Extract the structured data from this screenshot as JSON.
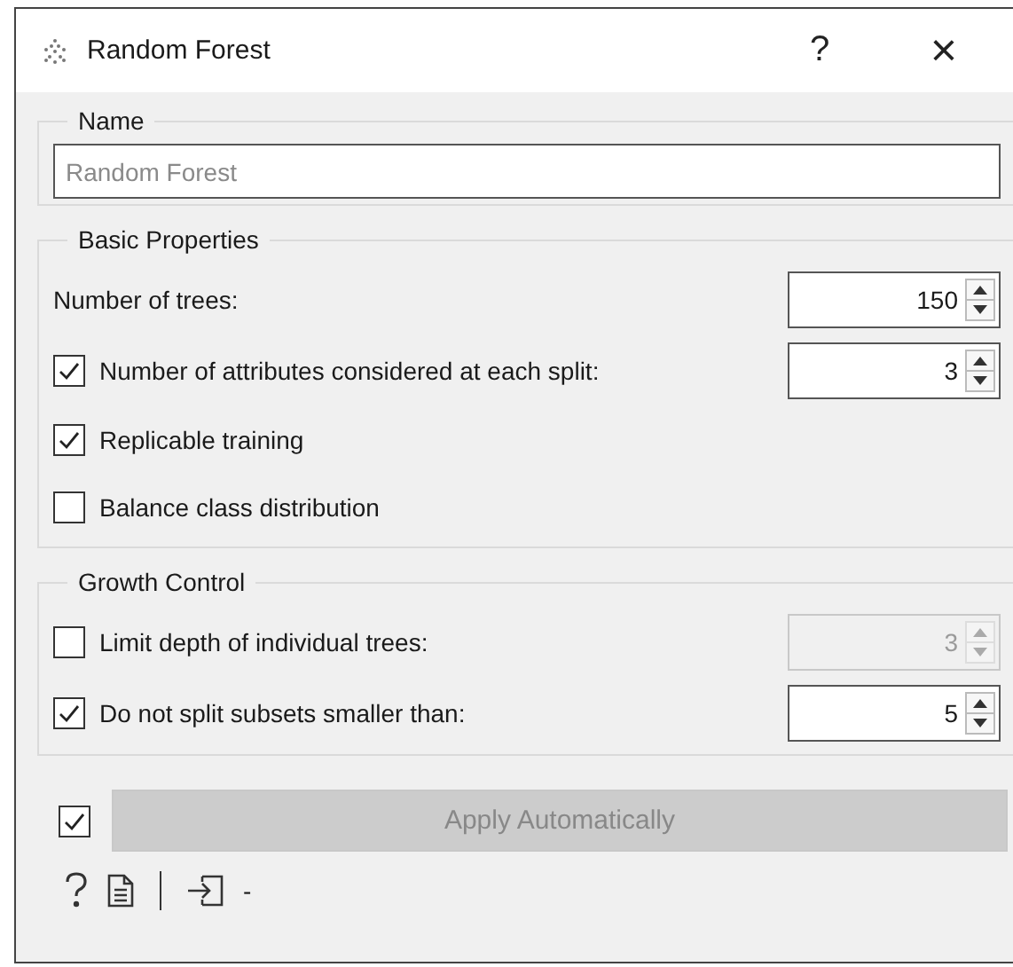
{
  "window": {
    "title": "Random Forest",
    "help": "?",
    "close": "×"
  },
  "name_group": {
    "title": "Name",
    "placeholder": "Random Forest"
  },
  "basic_properties": {
    "title": "Basic Properties",
    "rows": [
      {
        "kind": "spin",
        "label": "Number of trees:",
        "value": "150",
        "disabled": false
      },
      {
        "kind": "check-spin",
        "label": "Number of attributes considered at each split:",
        "checked": true,
        "value": "3",
        "disabled": false
      },
      {
        "kind": "check",
        "label": "Replicable training",
        "checked": true
      },
      {
        "kind": "check",
        "label": "Balance class distribution",
        "checked": false
      }
    ]
  },
  "growth_control": {
    "title": "Growth Control",
    "rows": [
      {
        "kind": "check-spin",
        "label": "Limit depth of individual trees:",
        "checked": false,
        "value": "3",
        "disabled": true
      },
      {
        "kind": "check-spin",
        "label": "Do not split subsets smaller than:",
        "checked": true,
        "value": "5",
        "disabled": false
      }
    ]
  },
  "apply": {
    "checked": true,
    "label": "Apply Automatically",
    "disabled": true
  },
  "status_bar": {
    "output": "-"
  }
}
